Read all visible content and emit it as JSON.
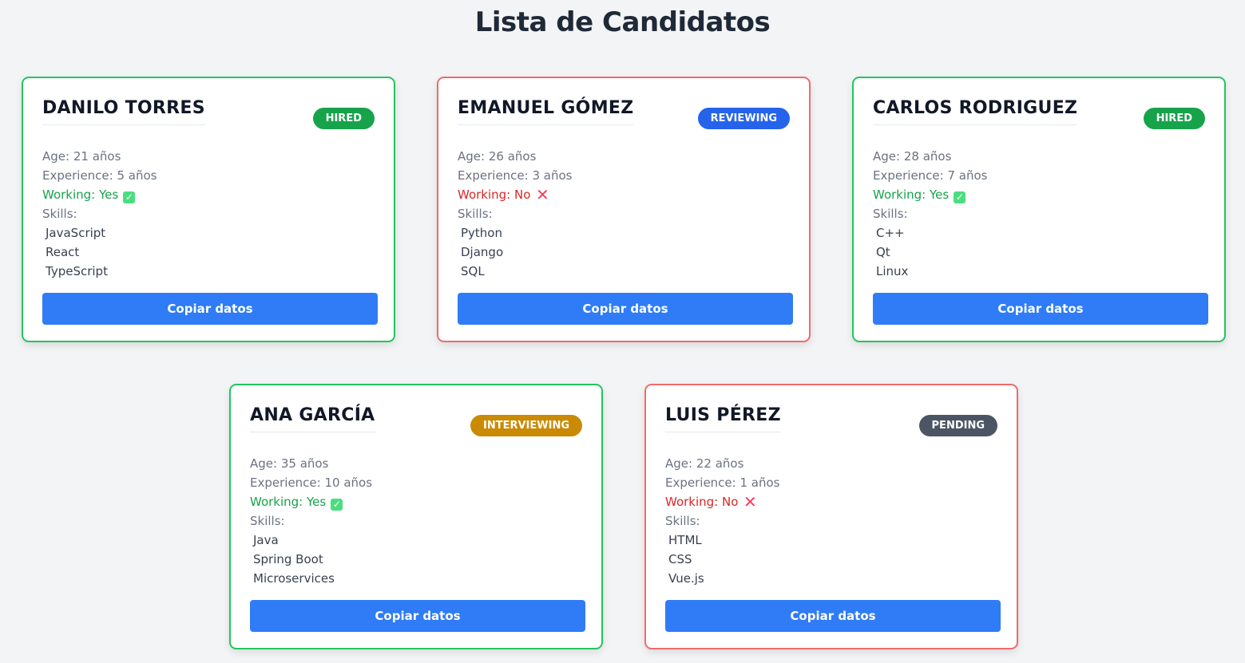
{
  "page": {
    "title": "Lista de Candidatos"
  },
  "colors": {
    "working_border": "#22c55e",
    "not_working_border": "#ef6b6b",
    "button": "#2f7cf6",
    "status": {
      "HIRED": "#16a34a",
      "REVIEWING": "#2563eb",
      "INTERVIEWING": "#ca8a04",
      "PENDING": "#4b5563"
    }
  },
  "candidates": [
    {
      "name": "DANILO TORRES",
      "status": "HIRED",
      "age": "Age: 21 años",
      "experience": "Experience: 5 años",
      "working": true,
      "working_text": "Working: Yes",
      "working_icon": "check-icon",
      "skills_label": "Skills:",
      "skills": [
        "JavaScript",
        "React",
        "TypeScript"
      ],
      "button_label": "Copiar datos"
    },
    {
      "name": "EMANUEL GÓMEZ",
      "status": "REVIEWING",
      "age": "Age: 26 años",
      "experience": "Experience: 3 años",
      "working": false,
      "working_text": "Working: No",
      "working_icon": "cross-icon",
      "skills_label": "Skills:",
      "skills": [
        "Python",
        "Django",
        "SQL"
      ],
      "button_label": "Copiar datos"
    },
    {
      "name": "CARLOS RODRIGUEZ",
      "status": "HIRED",
      "age": "Age: 28 años",
      "experience": "Experience: 7 años",
      "working": true,
      "working_text": "Working: Yes",
      "working_icon": "check-icon",
      "skills_label": "Skills:",
      "skills": [
        "C++",
        "Qt",
        "Linux"
      ],
      "button_label": "Copiar datos"
    },
    {
      "name": "ANA GARCÍA",
      "status": "INTERVIEWING",
      "age": "Age: 35 años",
      "experience": "Experience: 10 años",
      "working": true,
      "working_text": "Working: Yes",
      "working_icon": "check-icon",
      "skills_label": "Skills:",
      "skills": [
        "Java",
        "Spring Boot",
        "Microservices"
      ],
      "button_label": "Copiar datos"
    },
    {
      "name": "LUIS PÉREZ",
      "status": "PENDING",
      "age": "Age: 22 años",
      "experience": "Experience: 1 años",
      "working": false,
      "working_text": "Working: No",
      "working_icon": "cross-icon",
      "skills_label": "Skills:",
      "skills": [
        "HTML",
        "CSS",
        "Vue.js"
      ],
      "button_label": "Copiar datos"
    }
  ]
}
